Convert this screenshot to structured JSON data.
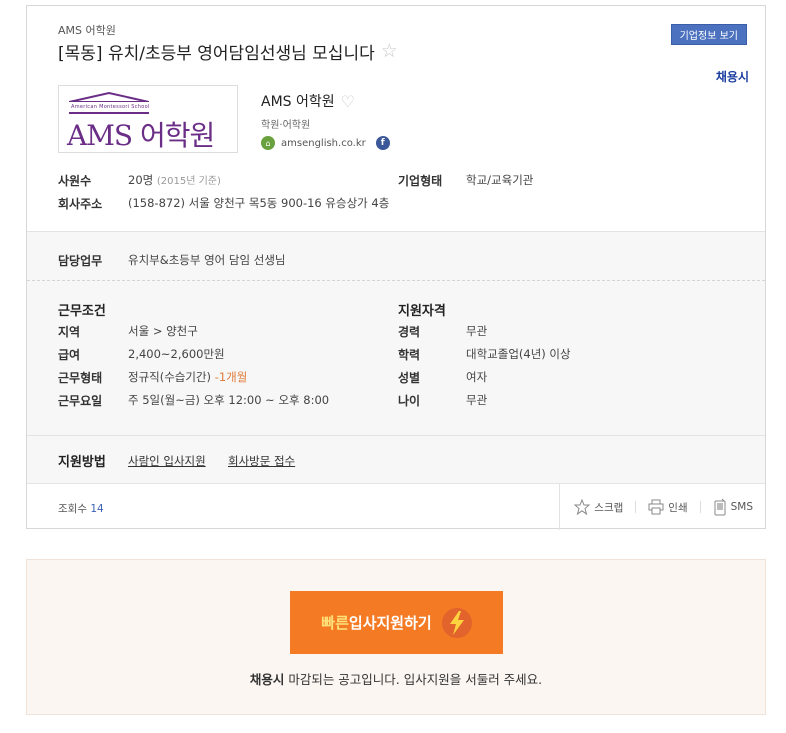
{
  "header": {
    "company_small": "AMS 어학원",
    "title": "[목동] 유치/초등부 영어담임선생님 모십니다",
    "company_info_button": "기업정보 보기",
    "deadline": "채용시"
  },
  "company": {
    "logo_text": "AMS 어학원",
    "logo_sub": "American Montessori School",
    "name": "AMS 어학원",
    "type": "학원·어학원",
    "website": "amsenglish.co.kr",
    "facebook_label": "f"
  },
  "summary": {
    "employees_label": "사원수",
    "employees_value": "20명",
    "employees_note": "(2015년 기준)",
    "company_type_label": "기업형태",
    "company_type_value": "학교/교육기관",
    "address_label": "회사주소",
    "address_value": "(158-872) 서울 양천구 목5동 900-16 유승상가 4층"
  },
  "duty": {
    "label": "담당업무",
    "value": "유치부&초등부 영어 담임 선생님"
  },
  "conditions": {
    "title": "근무조건",
    "rows": [
      {
        "label": "지역",
        "value": "서울 > 양천구"
      },
      {
        "label": "급여",
        "value": "2,400~2,600만원"
      },
      {
        "label": "근무형태",
        "value": "정규직(수습기간)",
        "extra": "-1개월"
      },
      {
        "label": "근무요일",
        "value": "주 5일(월~금) 오후 12:00 ~ 오후 8:00"
      }
    ]
  },
  "qualifications": {
    "title": "지원자격",
    "rows": [
      {
        "label": "경력",
        "value": "무관"
      },
      {
        "label": "학력",
        "value": "대학교졸업(4년) 이상"
      },
      {
        "label": "성별",
        "value": "여자"
      },
      {
        "label": "나이",
        "value": "무관"
      }
    ]
  },
  "apply_method": {
    "label": "지원방법",
    "links": [
      "사람인 입사지원",
      "회사방문 접수"
    ]
  },
  "footer": {
    "views_label": "조회수",
    "views_count": "14",
    "scrap": "스크랩",
    "print": "인쇄",
    "sms": "SMS"
  },
  "apply_box": {
    "button_highlight": "빠른",
    "button_text": "입사지원하기",
    "notice_bold": "채용시",
    "notice_text": " 마감되는 공고입니다. 입사지원을 서둘러 주세요."
  },
  "colors": {
    "accent_blue": "#4c72bf",
    "deadline_blue": "#1a3da0",
    "apply_orange": "#f47a24",
    "logo_purple": "#6b2e87"
  }
}
